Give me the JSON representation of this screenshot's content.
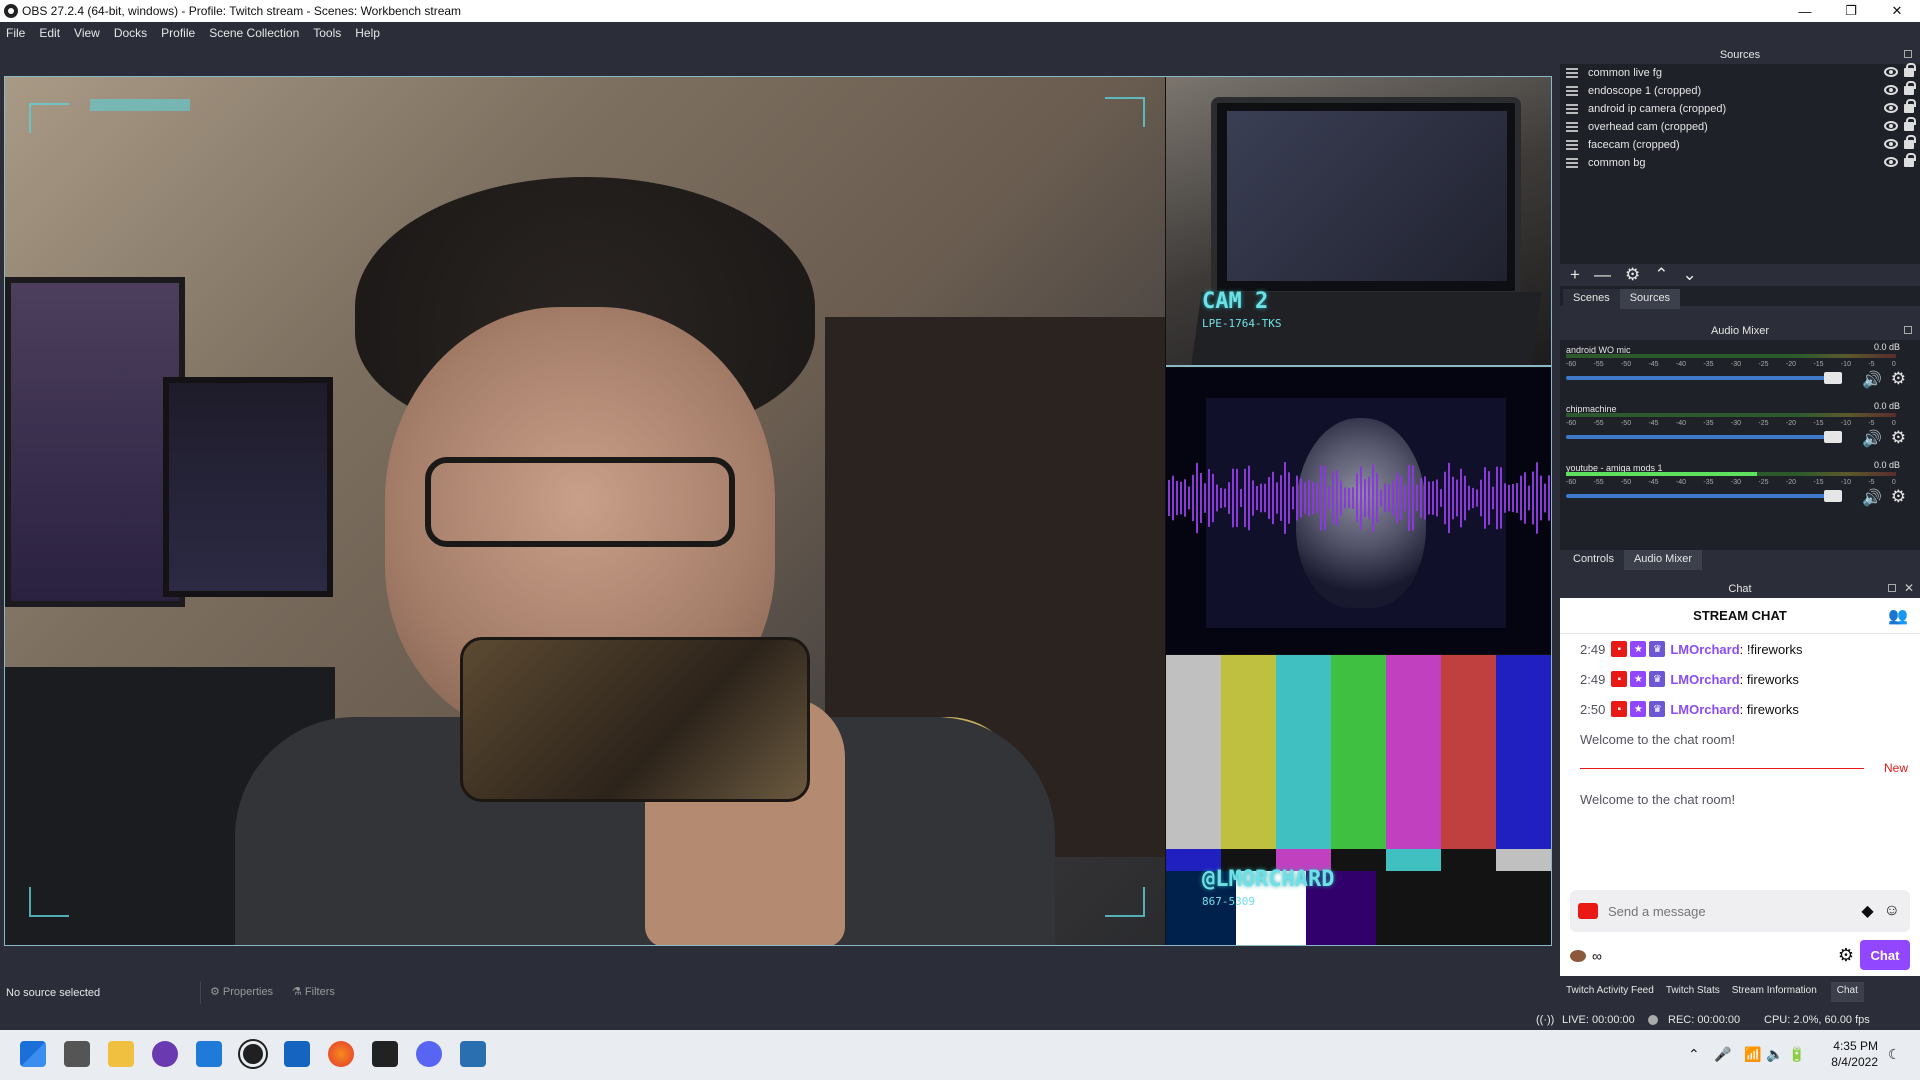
{
  "window": {
    "title": "OBS 27.2.4 (64-bit, windows) - Profile: Twitch stream - Scenes: Workbench stream",
    "minimize_icon": "—",
    "maximize_icon": "❐",
    "close_icon": "✕"
  },
  "menu": [
    "File",
    "Edit",
    "View",
    "Docks",
    "Profile",
    "Scene Collection",
    "Tools",
    "Help"
  ],
  "preview": {
    "cam2_label": "CAM 2",
    "cam2_sub": "LPE-1764-TKS",
    "bars_label": "@LMORCHARD",
    "bars_sub": "867-5309"
  },
  "sources_panel": {
    "title": "Sources",
    "items": [
      {
        "name": "common live fg"
      },
      {
        "name": "endoscope 1 (cropped)"
      },
      {
        "name": "android ip camera (cropped)"
      },
      {
        "name": "overhead cam (cropped)"
      },
      {
        "name": "facecam (cropped)"
      },
      {
        "name": "common bg"
      }
    ],
    "toolbar": {
      "add": "+",
      "remove": "—",
      "settings": "⚙",
      "up": "⌃",
      "down": "⌄"
    },
    "tabs": {
      "scenes": "Scenes",
      "sources": "Sources"
    }
  },
  "audio_mixer": {
    "title": "Audio Mixer",
    "ticks": [
      "-60",
      "-55",
      "-50",
      "-45",
      "-40",
      "-35",
      "-30",
      "-25",
      "-20",
      "-15",
      "-10",
      "-5",
      "0"
    ],
    "channels": [
      {
        "name": "android WO mic",
        "db": "0.0 dB",
        "level": 0.0
      },
      {
        "name": "chipmachine",
        "db": "0.0 dB",
        "level": 0.0
      },
      {
        "name": "youtube - amiga mods 1",
        "db": "0.0 dB",
        "level": 0.58
      }
    ],
    "tabs": {
      "controls": "Controls",
      "audio_mixer": "Audio Mixer"
    }
  },
  "chat_panel": {
    "title": "Chat",
    "header": "STREAM CHAT",
    "messages": [
      {
        "time": "2:49",
        "user": "LMOrchard",
        "text": ": !fireworks"
      },
      {
        "time": "2:49",
        "user": "LMOrchard",
        "text": ": fireworks"
      },
      {
        "time": "2:50",
        "user": "LMOrchard",
        "text": ": fireworks"
      }
    ],
    "welcome_1": "Welcome to the chat room!",
    "new_label": "New",
    "welcome_2": "Welcome to the chat room!",
    "input_placeholder": "Send a message",
    "points": "∞",
    "chat_button": "Chat"
  },
  "bottom_tabs": [
    "Twitch Activity Feed",
    "Twitch Stats",
    "Stream Information",
    "Chat"
  ],
  "status_strip": {
    "no_source": "No source selected",
    "properties": "Properties",
    "filters": "Filters"
  },
  "statusbar": {
    "live": "LIVE: 00:00:00",
    "rec": "REC: 00:00:00",
    "cpu": "CPU: 2.0%, 60.00 fps"
  },
  "taskbar": {
    "time": "4:35 PM",
    "date": "8/4/2022"
  },
  "colors": {
    "obs_bg": "#2b2e38",
    "dock_bg": "#1f2128",
    "twitch_purple": "#9147ff",
    "twitch_red": "#e91916",
    "hud_cyan": "#5fd0d8"
  }
}
